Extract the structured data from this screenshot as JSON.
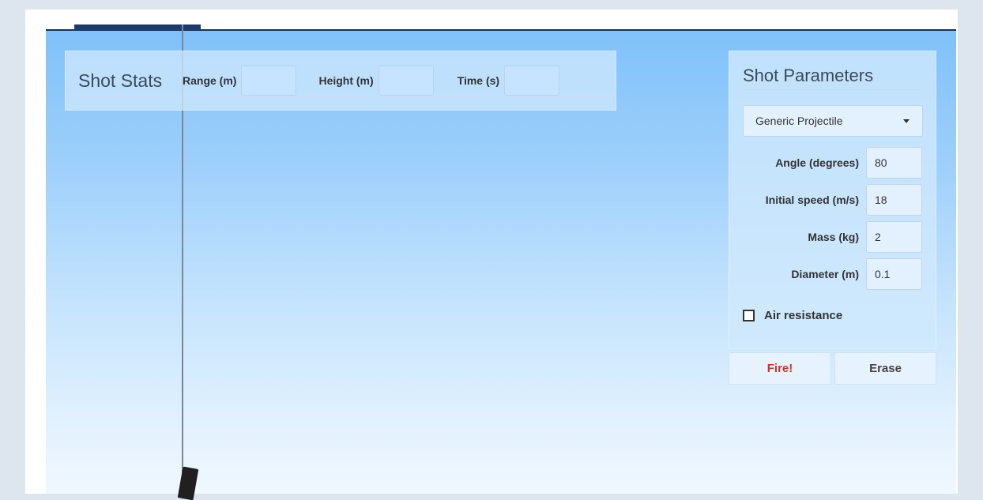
{
  "shot_stats": {
    "title": "Shot Stats",
    "range_label": "Range (m)",
    "range_value": "",
    "height_label": "Height (m)",
    "height_value": "",
    "time_label": "Time (s)",
    "time_value": ""
  },
  "shot_parameters": {
    "title": "Shot Parameters",
    "projectile_select": "Generic Projectile",
    "angle_label": "Angle (degrees)",
    "angle_value": "80",
    "speed_label": "Initial speed (m/s)",
    "speed_value": "18",
    "mass_label": "Mass (kg)",
    "mass_value": "2",
    "diameter_label": "Diameter (m)",
    "diameter_value": "0.1",
    "air_resistance_label": "Air resistance",
    "air_resistance_checked": false
  },
  "buttons": {
    "fire": "Fire!",
    "erase": "Erase"
  },
  "colors": {
    "fire_text": "#c0392b",
    "sky_top": "#7fc1f9",
    "sky_bottom": "#f0f8ff"
  }
}
